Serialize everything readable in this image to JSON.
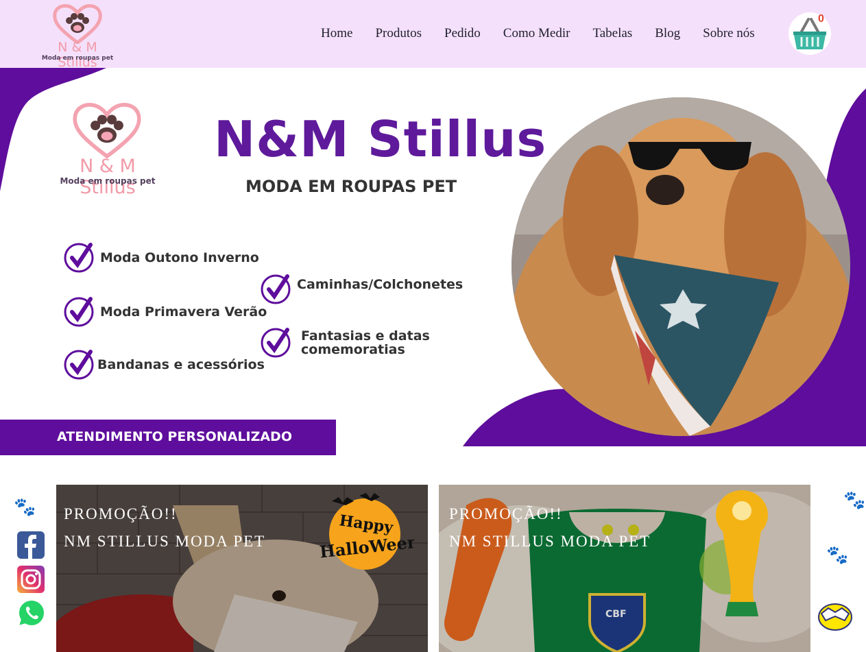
{
  "brand": {
    "name": "N & M Stillus",
    "tagline": "Moda em roupas pet"
  },
  "nav": {
    "items": [
      "Home",
      "Produtos",
      "Pedido",
      "Como Medir",
      "Tabelas",
      "Blog",
      "Sobre nós"
    ]
  },
  "cart": {
    "count": "0"
  },
  "hero": {
    "logo_name": "N & M Stillus",
    "logo_tagline": "Moda em roupas pet",
    "title": "N&M Stillus",
    "subtitle": "MODA EM ROUPAS PET",
    "features": [
      "Moda Outono Inverno",
      "Moda Primavera Verão",
      "Bandanas e acessórios",
      "Caminhas/Colchonetes",
      "Fantasias e datas comemoratias"
    ],
    "banner": "ATENDIMENTO PERSONALIZADO"
  },
  "promos": [
    {
      "line1": "PROMOÇÃO!!",
      "line2": "NM STILLUS MODA PET",
      "badge": "Happy Halloween"
    },
    {
      "line1": "PROMOÇÃO!!",
      "line2": "NM STILLUS MODA PET",
      "badge": "CBF"
    }
  ],
  "social": [
    "facebook",
    "instagram",
    "whatsapp"
  ],
  "colors": {
    "header_bg": "#f5e0fb",
    "brand_purple": "#5e0d9c",
    "brand_pink": "#f29aa8"
  }
}
